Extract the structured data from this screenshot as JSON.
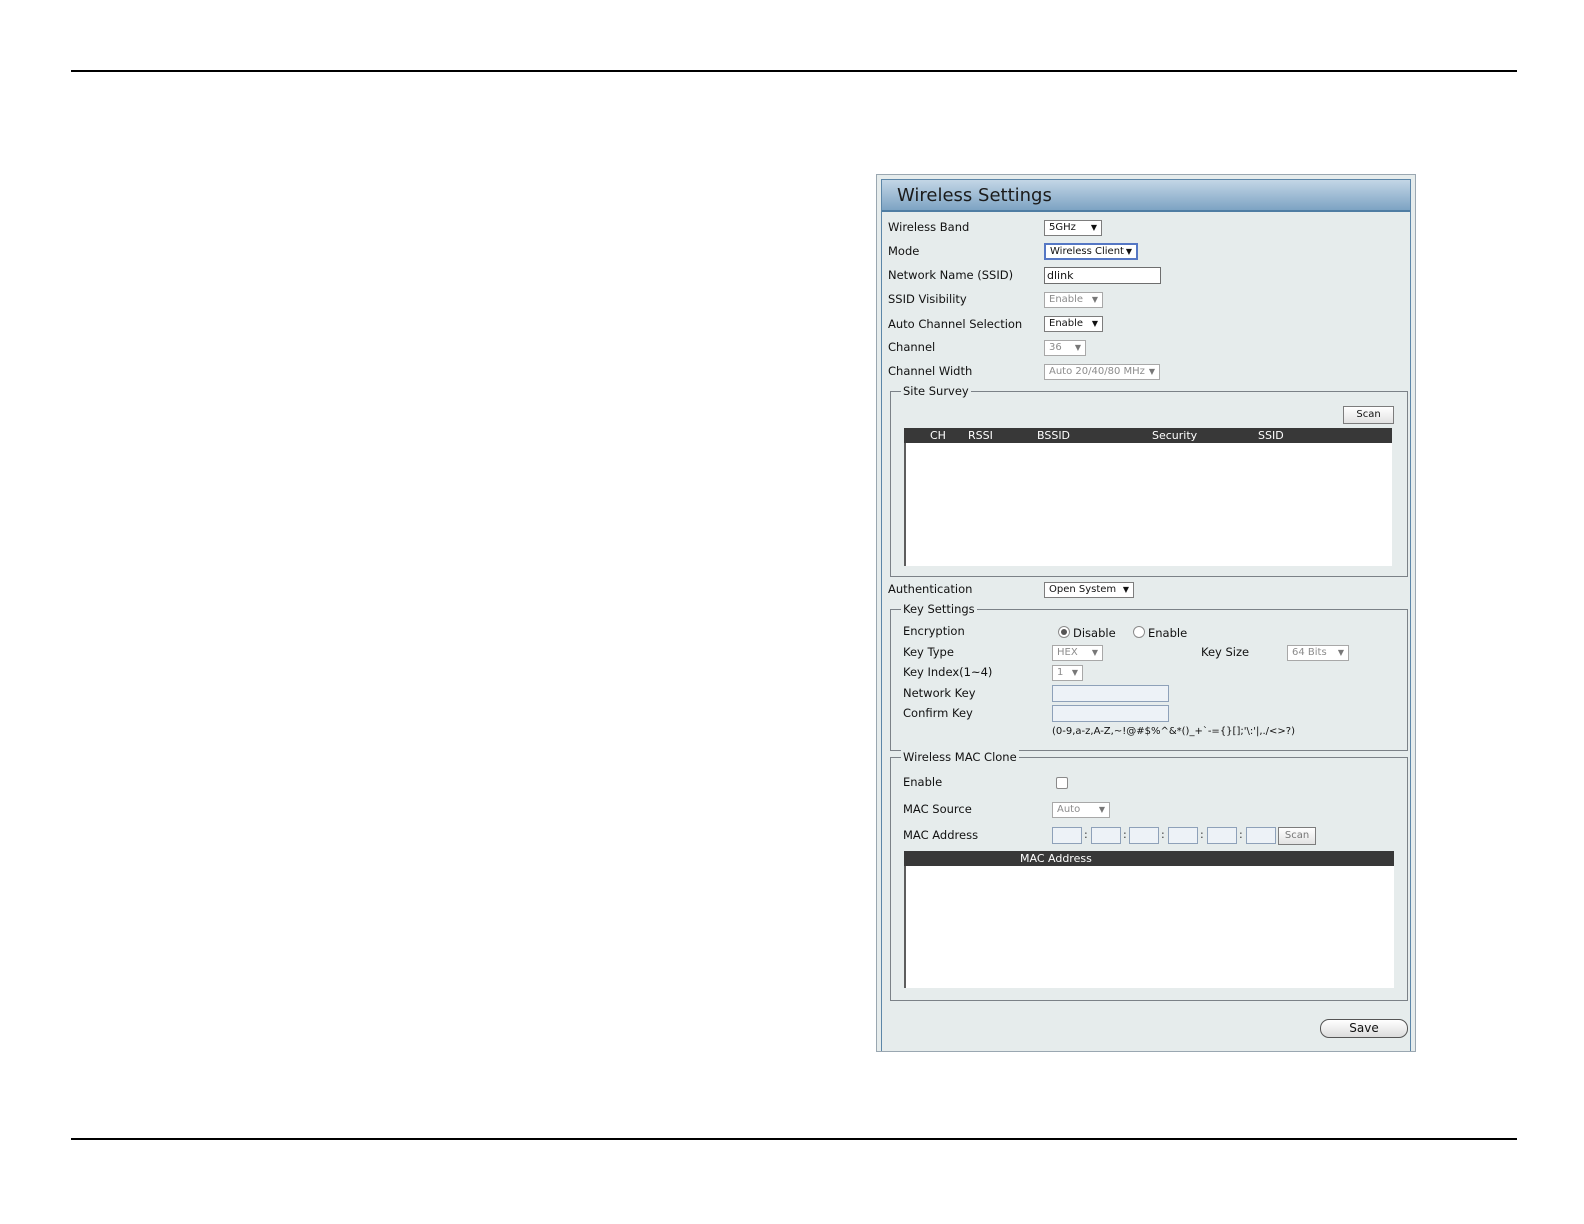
{
  "panel": {
    "title": "Wireless Settings"
  },
  "fields": {
    "wireless_band": {
      "label": "Wireless Band",
      "value": "5GHz"
    },
    "mode": {
      "label": "Mode",
      "value": "Wireless Client"
    },
    "ssid": {
      "label": "Network Name (SSID)",
      "value": "dlink"
    },
    "ssid_visibility": {
      "label": "SSID Visibility",
      "value": "Enable"
    },
    "auto_channel": {
      "label": "Auto Channel Selection",
      "value": "Enable"
    },
    "channel": {
      "label": "Channel",
      "value": "36"
    },
    "channel_width": {
      "label": "Channel Width",
      "value": "Auto 20/40/80 MHz"
    },
    "authentication": {
      "label": "Authentication",
      "value": "Open System"
    }
  },
  "site_survey": {
    "legend": "Site Survey",
    "scan_label": "Scan",
    "columns": [
      "CH",
      "RSSI",
      "BSSID",
      "Security",
      "SSID"
    ]
  },
  "key_settings": {
    "legend": "Key Settings",
    "encryption": {
      "label": "Encryption",
      "option_disable": "Disable",
      "option_enable": "Enable",
      "selected": "Disable"
    },
    "key_type": {
      "label": "Key Type",
      "value": "HEX"
    },
    "key_size": {
      "label": "Key Size",
      "value": "64 Bits"
    },
    "key_index": {
      "label": "Key Index(1~4)",
      "value": "1"
    },
    "network_key": {
      "label": "Network Key"
    },
    "confirm_key": {
      "label": "Confirm Key"
    },
    "hint": "(0-9,a-z,A-Z,~!@#$%^&*()_+`-={}[];'\\:'|,./<>?)"
  },
  "mac_clone": {
    "legend": "Wireless MAC Clone",
    "enable_label": "Enable",
    "enable_checked": false,
    "source": {
      "label": "MAC Source",
      "value": "Auto"
    },
    "address_label": "MAC Address",
    "scan_label": "Scan",
    "table_header": "MAC Address"
  },
  "save_label": "Save"
}
